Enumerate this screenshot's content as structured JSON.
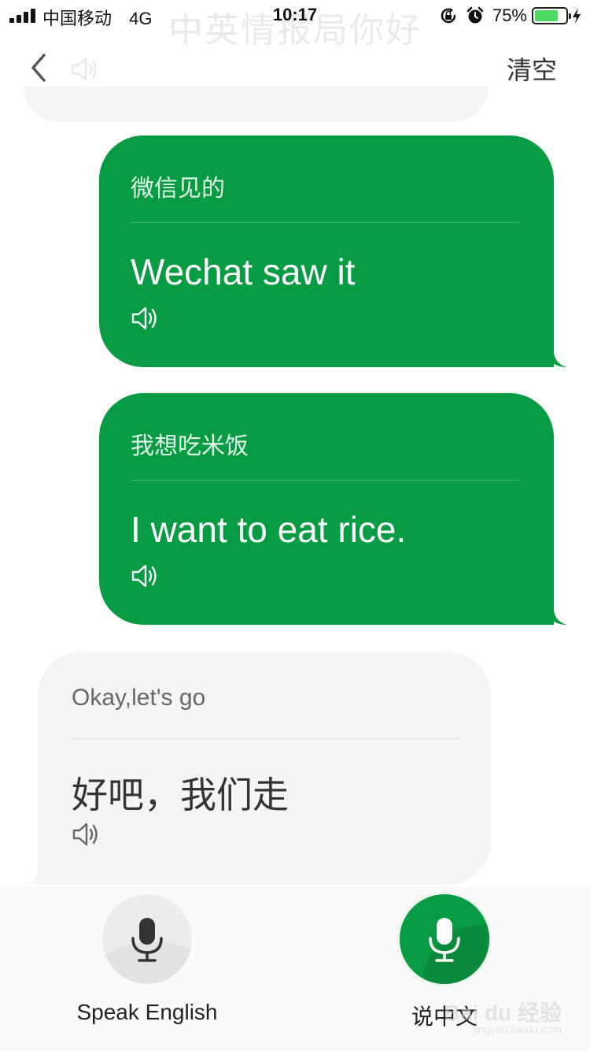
{
  "status_bar": {
    "carrier": "中国移动",
    "network": "4G",
    "time": "10:17",
    "battery_percent": "75%",
    "battery_level": 0.75,
    "icons": [
      "signal-icon",
      "rotation-lock-icon",
      "alarm-icon",
      "battery-icon",
      "charging-icon"
    ]
  },
  "header": {
    "ghost_title": "中英情报局你好",
    "back_icon": "chevron-left-icon",
    "clear_label": "清空"
  },
  "messages": [
    {
      "side": "me",
      "source": "微信见的",
      "translation": "Wechat saw it",
      "speaker_icon": "speaker-icon"
    },
    {
      "side": "me",
      "source": "我想吃米饭",
      "translation": "I want to eat rice.",
      "speaker_icon": "speaker-icon"
    },
    {
      "side": "them",
      "source": "Okay,let's go",
      "translation": "好吧，我们走",
      "speaker_icon": "speaker-icon"
    }
  ],
  "bottom_bar": {
    "speak_english_label": "Speak English",
    "speak_chinese_label": "说中文",
    "mic_icon": "microphone-icon"
  },
  "watermark": {
    "main": "Bai du 经验",
    "sub": "jingyan.baidu.com"
  },
  "colors": {
    "accent_green": "#079c43",
    "bubble_gray": "#f4f4f4"
  }
}
